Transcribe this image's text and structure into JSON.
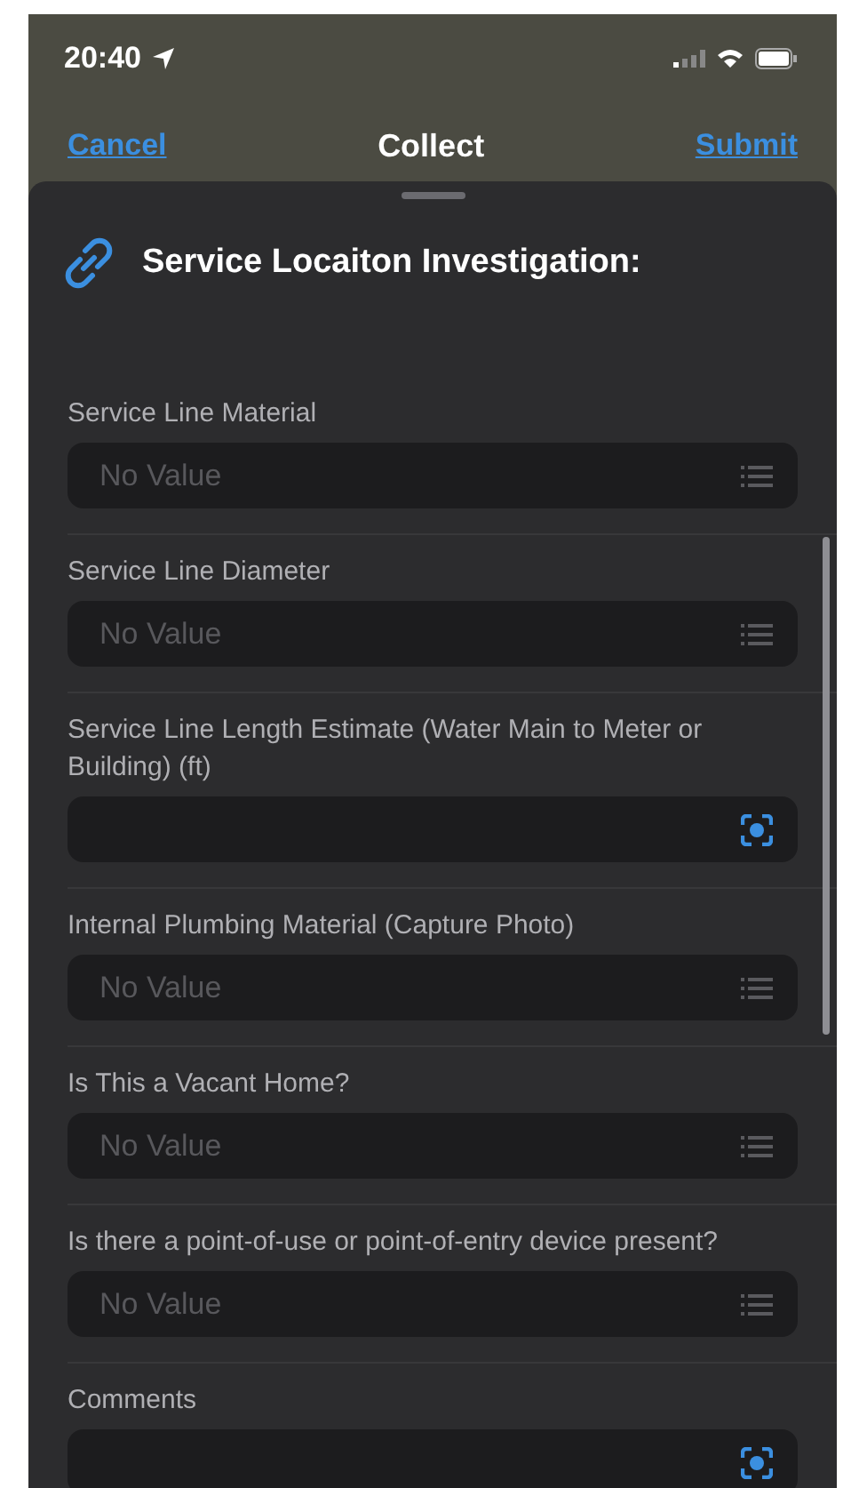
{
  "status_bar": {
    "time": "20:40"
  },
  "nav": {
    "cancel": "Cancel",
    "title": "Collect",
    "submit": "Submit"
  },
  "form": {
    "title": "Service Locaiton Investigation:",
    "fields": [
      {
        "label": "Service Line Material",
        "kind": "choice",
        "placeholder": "No Value"
      },
      {
        "label": "Service Line Diameter",
        "kind": "choice",
        "placeholder": "No Value"
      },
      {
        "label": "Service Line Length Estimate (Water Main to Meter or Building) (ft)",
        "kind": "scan"
      },
      {
        "label": "Internal Plumbing Material (Capture Photo)",
        "kind": "choice",
        "placeholder": "No Value"
      },
      {
        "label": "Is This a Vacant Home?",
        "kind": "choice",
        "placeholder": "No Value"
      },
      {
        "label": "Is there a point-of-use or point-of-entry device present?",
        "kind": "choice",
        "placeholder": "No Value"
      },
      {
        "label": "Comments",
        "kind": "scan"
      }
    ]
  }
}
